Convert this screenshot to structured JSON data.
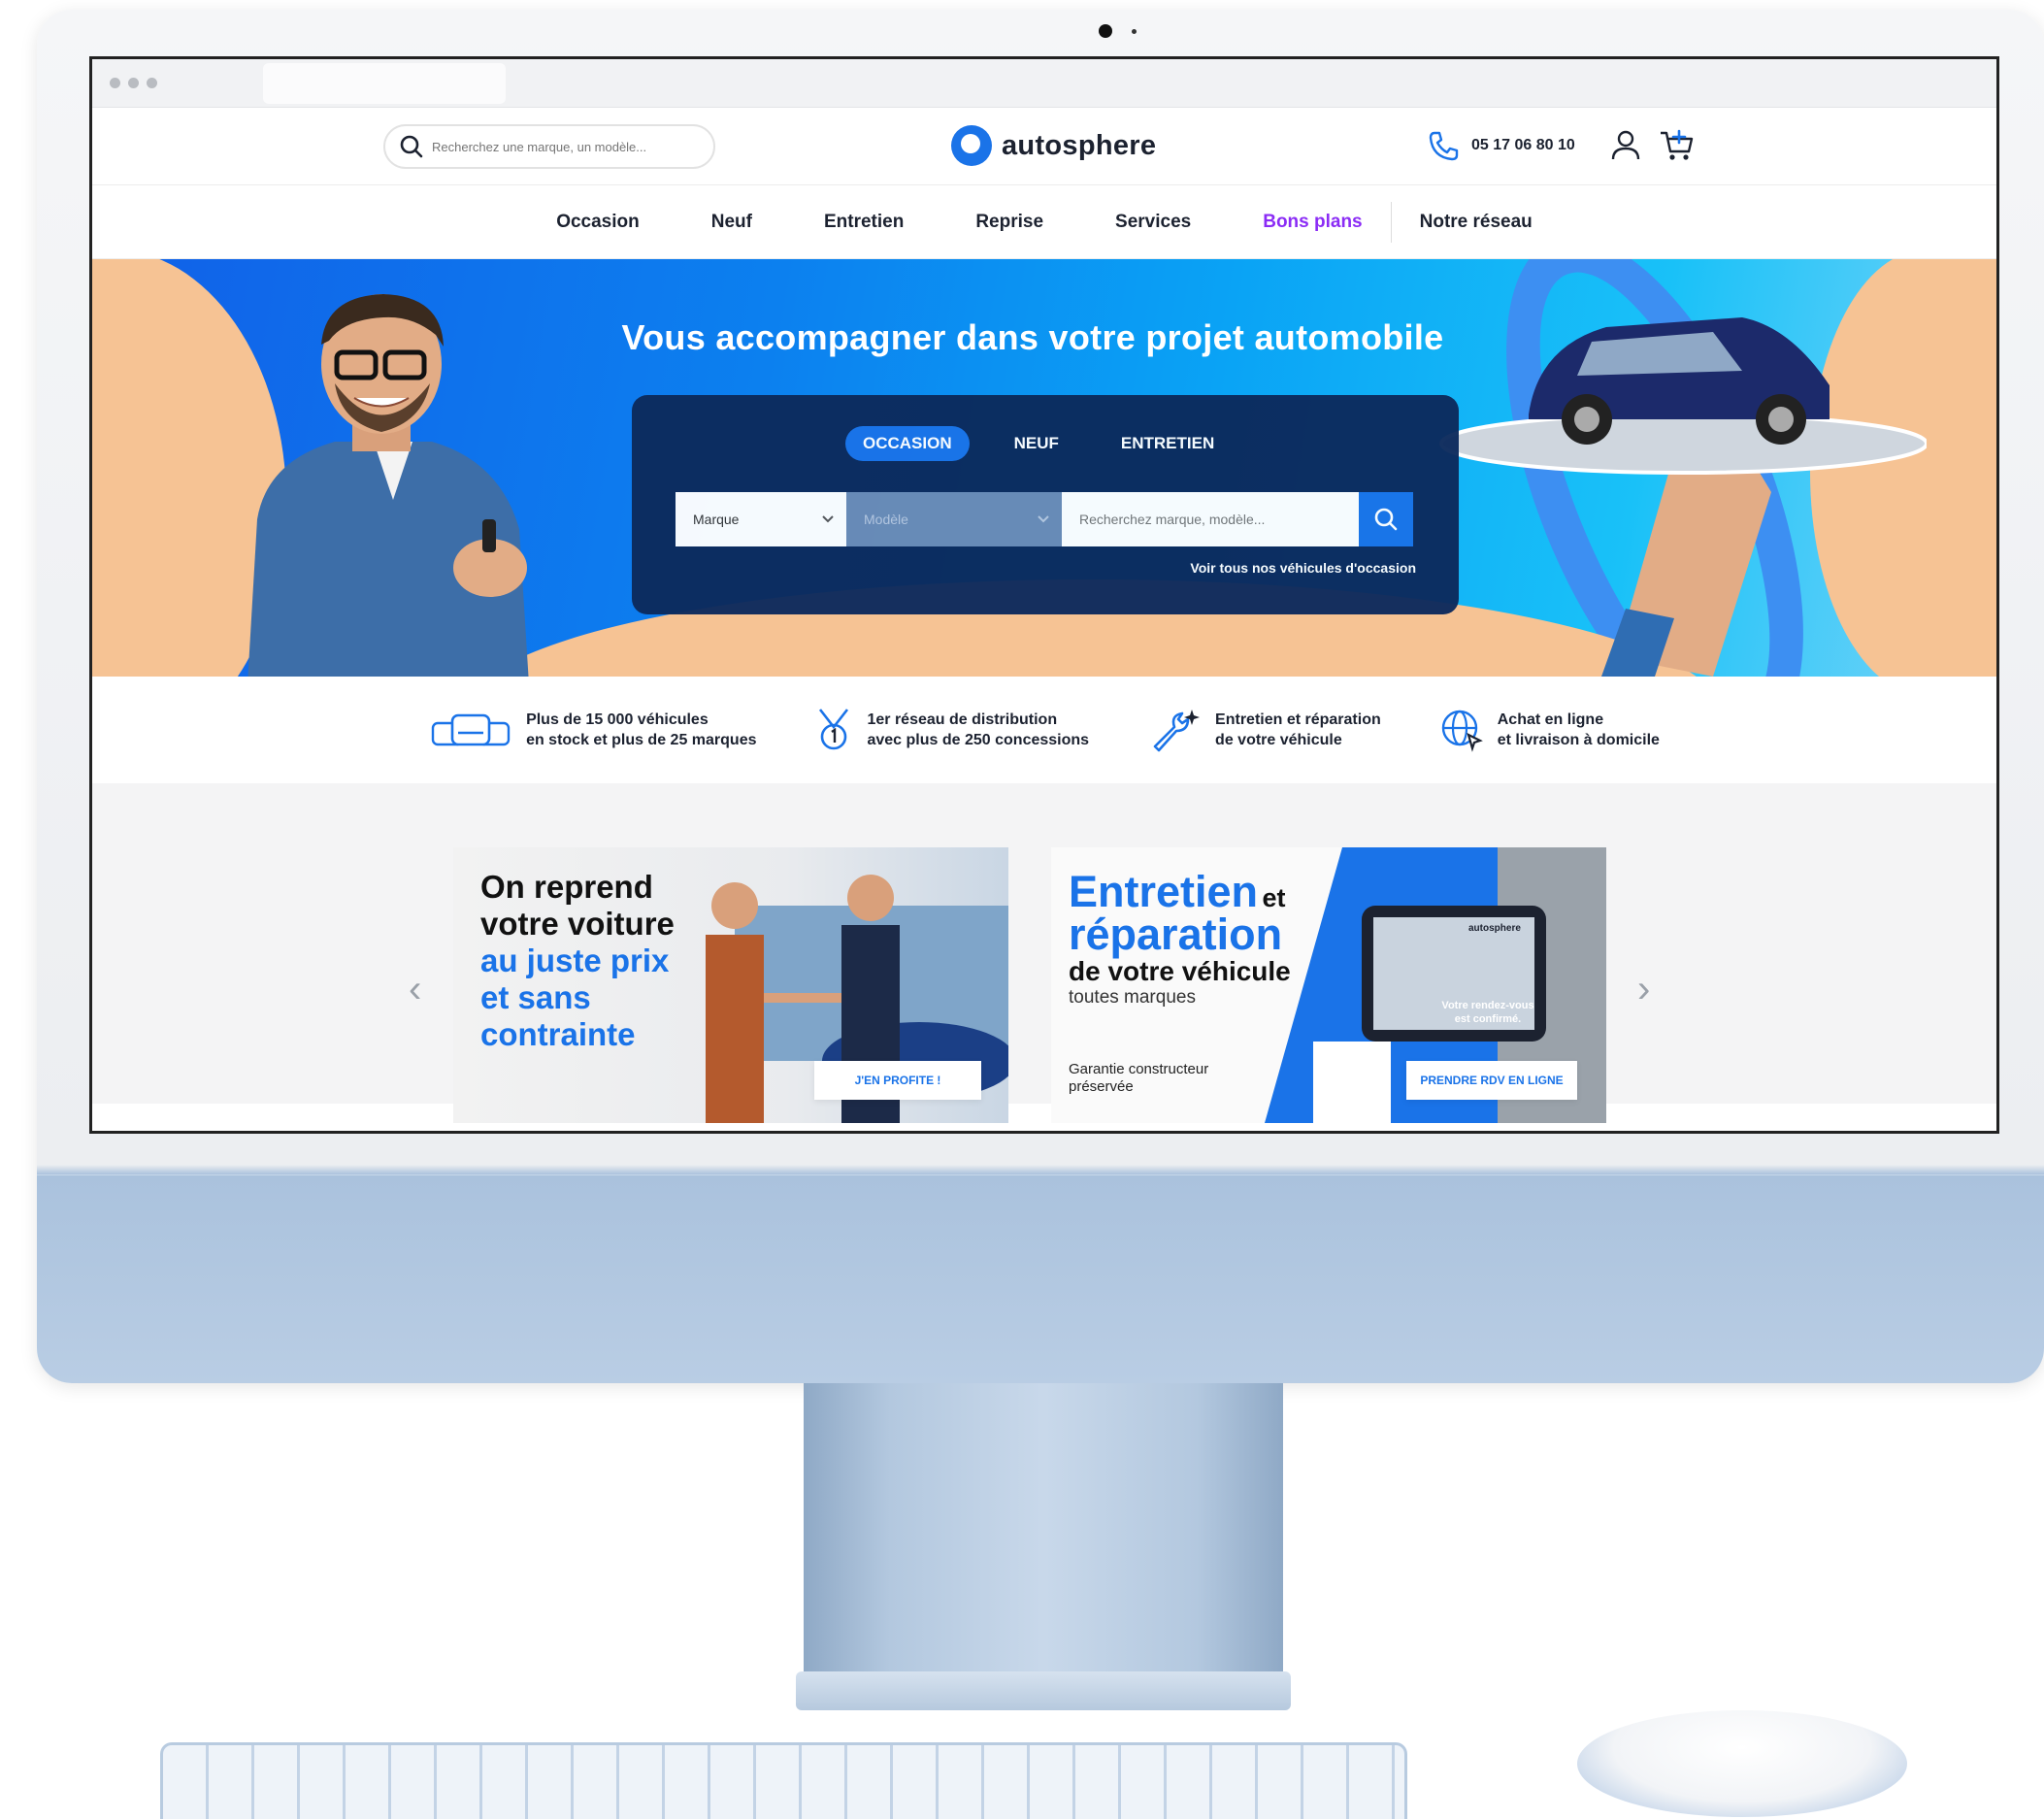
{
  "header": {
    "search_placeholder": "Recherchez une marque, un modèle...",
    "logo_text": "autosphere",
    "phone": "05 17 06 80 10"
  },
  "nav": {
    "items": [
      "Occasion",
      "Neuf",
      "Entretien",
      "Reprise",
      "Services",
      "Bons plans",
      "Notre réseau"
    ],
    "highlight_color": "#8b2cf5"
  },
  "hero": {
    "title": "Vous accompagner dans votre projet automobile",
    "tabs": [
      "OCCASION",
      "NEUF",
      "ENTRETIEN"
    ],
    "active_tab": "OCCASION",
    "marque_label": "Marque",
    "modele_label": "Modèle",
    "search_placeholder": "Recherchez marque, modèle...",
    "see_all": "Voir tous nos véhicules d'occasion"
  },
  "features": [
    {
      "icon": "cars-icon",
      "line1": "Plus de 15 000 véhicules",
      "line2": "en stock et plus de 25 marques"
    },
    {
      "icon": "medal-icon",
      "line1": "1er réseau de distribution",
      "line2": "avec plus de 250 concessions"
    },
    {
      "icon": "wrench-icon",
      "line1": "Entretien et réparation",
      "line2": "de votre véhicule"
    },
    {
      "icon": "globe-cursor-icon",
      "line1": "Achat en ligne",
      "line2": "et livraison à domicile"
    }
  ],
  "promo": {
    "card1": {
      "line1": "On reprend",
      "line2": "votre voiture",
      "line3": "au juste prix",
      "line4": "et sans",
      "line5": "contrainte",
      "button": "J'EN PROFITE !"
    },
    "card2": {
      "title1": "Entretien",
      "title_et": "et",
      "title2": "réparation",
      "subtitle": "de votre véhicule",
      "brands": "toutes marques",
      "guarantee1": "Garantie constructeur",
      "guarantee2": "préservée",
      "tablet_brand": "autosphere",
      "tablet_msg1": "Votre rendez-vous",
      "tablet_msg2": "est confirmé.",
      "button": "PRENDRE RDV EN LIGNE"
    }
  },
  "colors": {
    "brand_blue": "#1a73e8",
    "navy": "#0c2a5c",
    "peach": "#f6c394",
    "imac_blue": "#b9cde4"
  }
}
